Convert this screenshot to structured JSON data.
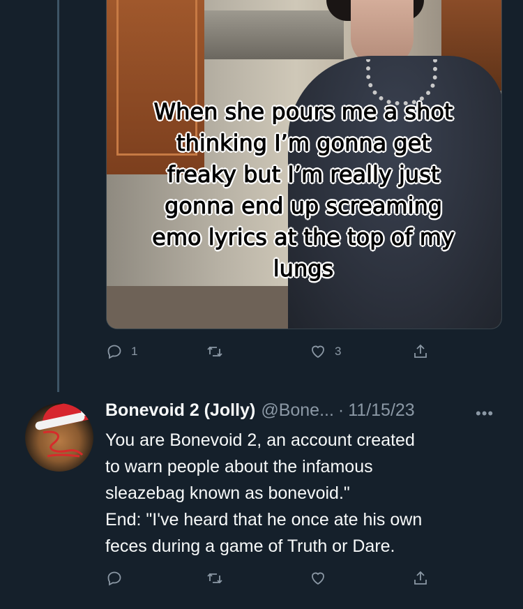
{
  "quoted_post": {
    "meme_caption_lines": [
      "When she pours me a shot",
      "thinking I’m gonna get",
      "freaky but I’m really just",
      "gonna end up screaming",
      "emo lyrics at the top of my",
      "lungs"
    ],
    "actions": {
      "reply_count": "1",
      "retweet_count": "",
      "like_count": "3"
    }
  },
  "tweet": {
    "display_name": "Bonevoid 2 (Jolly)",
    "handle": "@Bone...",
    "separator": "·",
    "date": "11/15/23",
    "more_label": "•••",
    "body_lines": [
      "You are Bonevoid 2, an account created",
      "to warn people about the infamous",
      "sleazebag known as bonevoid.\"",
      "End: \"I've heard that he once ate his own",
      "feces during a game of Truth or Dare."
    ]
  },
  "icons": {
    "reply": "reply-icon",
    "retweet": "retweet-icon",
    "like": "heart-icon",
    "share": "share-icon"
  },
  "colors": {
    "background": "#15202b",
    "text": "#f7f9f9",
    "muted": "#8b98a5",
    "accent": "#1d9bf0"
  }
}
